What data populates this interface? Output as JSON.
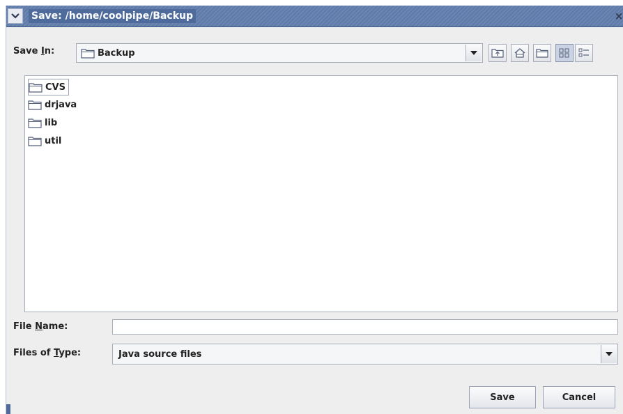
{
  "window": {
    "title": "Save:  /home/coolpipe/Backup",
    "menu_icon": "chevron-down-icon",
    "close_glyph": "×"
  },
  "save_in": {
    "label_pre": "Save ",
    "label_mn": "I",
    "label_post": "n:",
    "value": "Backup",
    "icon": "folder-icon"
  },
  "toolbar": {
    "buttons": [
      {
        "name": "up-one-level-button",
        "icon": "folder-up-icon"
      },
      {
        "name": "home-button",
        "icon": "home-icon"
      },
      {
        "name": "new-folder-button",
        "icon": "new-folder-icon"
      },
      {
        "name": "list-view-button",
        "icon": "list-view-icon",
        "active": true
      },
      {
        "name": "details-view-button",
        "icon": "details-view-icon"
      }
    ]
  },
  "files": [
    {
      "name": "CVS"
    },
    {
      "name": "drjava"
    },
    {
      "name": "lib"
    },
    {
      "name": "util"
    }
  ],
  "file_name": {
    "label_pre": "File ",
    "label_mn": "N",
    "label_post": "ame:",
    "value": ""
  },
  "file_type": {
    "label_pre": "Files of ",
    "label_mn": "T",
    "label_post": "ype:",
    "value": "Java source files"
  },
  "buttons": {
    "save": "Save",
    "cancel": "Cancel"
  },
  "colors": {
    "titlebar": "#5f7aa8",
    "window_bg": "#eeeeee",
    "list_bg": "#ffffff"
  }
}
